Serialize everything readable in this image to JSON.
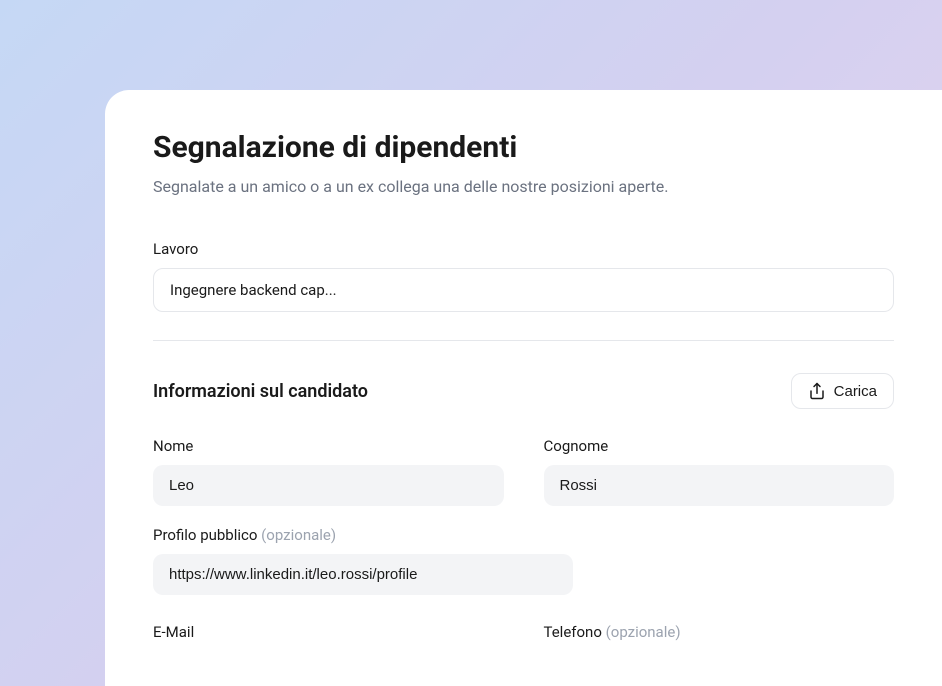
{
  "header": {
    "title": "Segnalazione di dipendenti",
    "subtitle": "Segnalate a un amico o a un ex collega una delle nostre posizioni aperte."
  },
  "jobField": {
    "label": "Lavoro",
    "value": "Ingegnere backend cap..."
  },
  "candidateSection": {
    "title": "Informazioni sul candidato",
    "uploadLabel": "Carica"
  },
  "fields": {
    "firstName": {
      "label": "Nome",
      "value": "Leo"
    },
    "lastName": {
      "label": "Cognome",
      "value": "Rossi"
    },
    "publicProfile": {
      "label": "Profilo pubblico",
      "optional": "(opzionale)",
      "value": "https://www.linkedin.it/leo.rossi/profile"
    },
    "email": {
      "label": "E-Mail"
    },
    "phone": {
      "label": "Telefono",
      "optional": "(opzionale)"
    }
  }
}
